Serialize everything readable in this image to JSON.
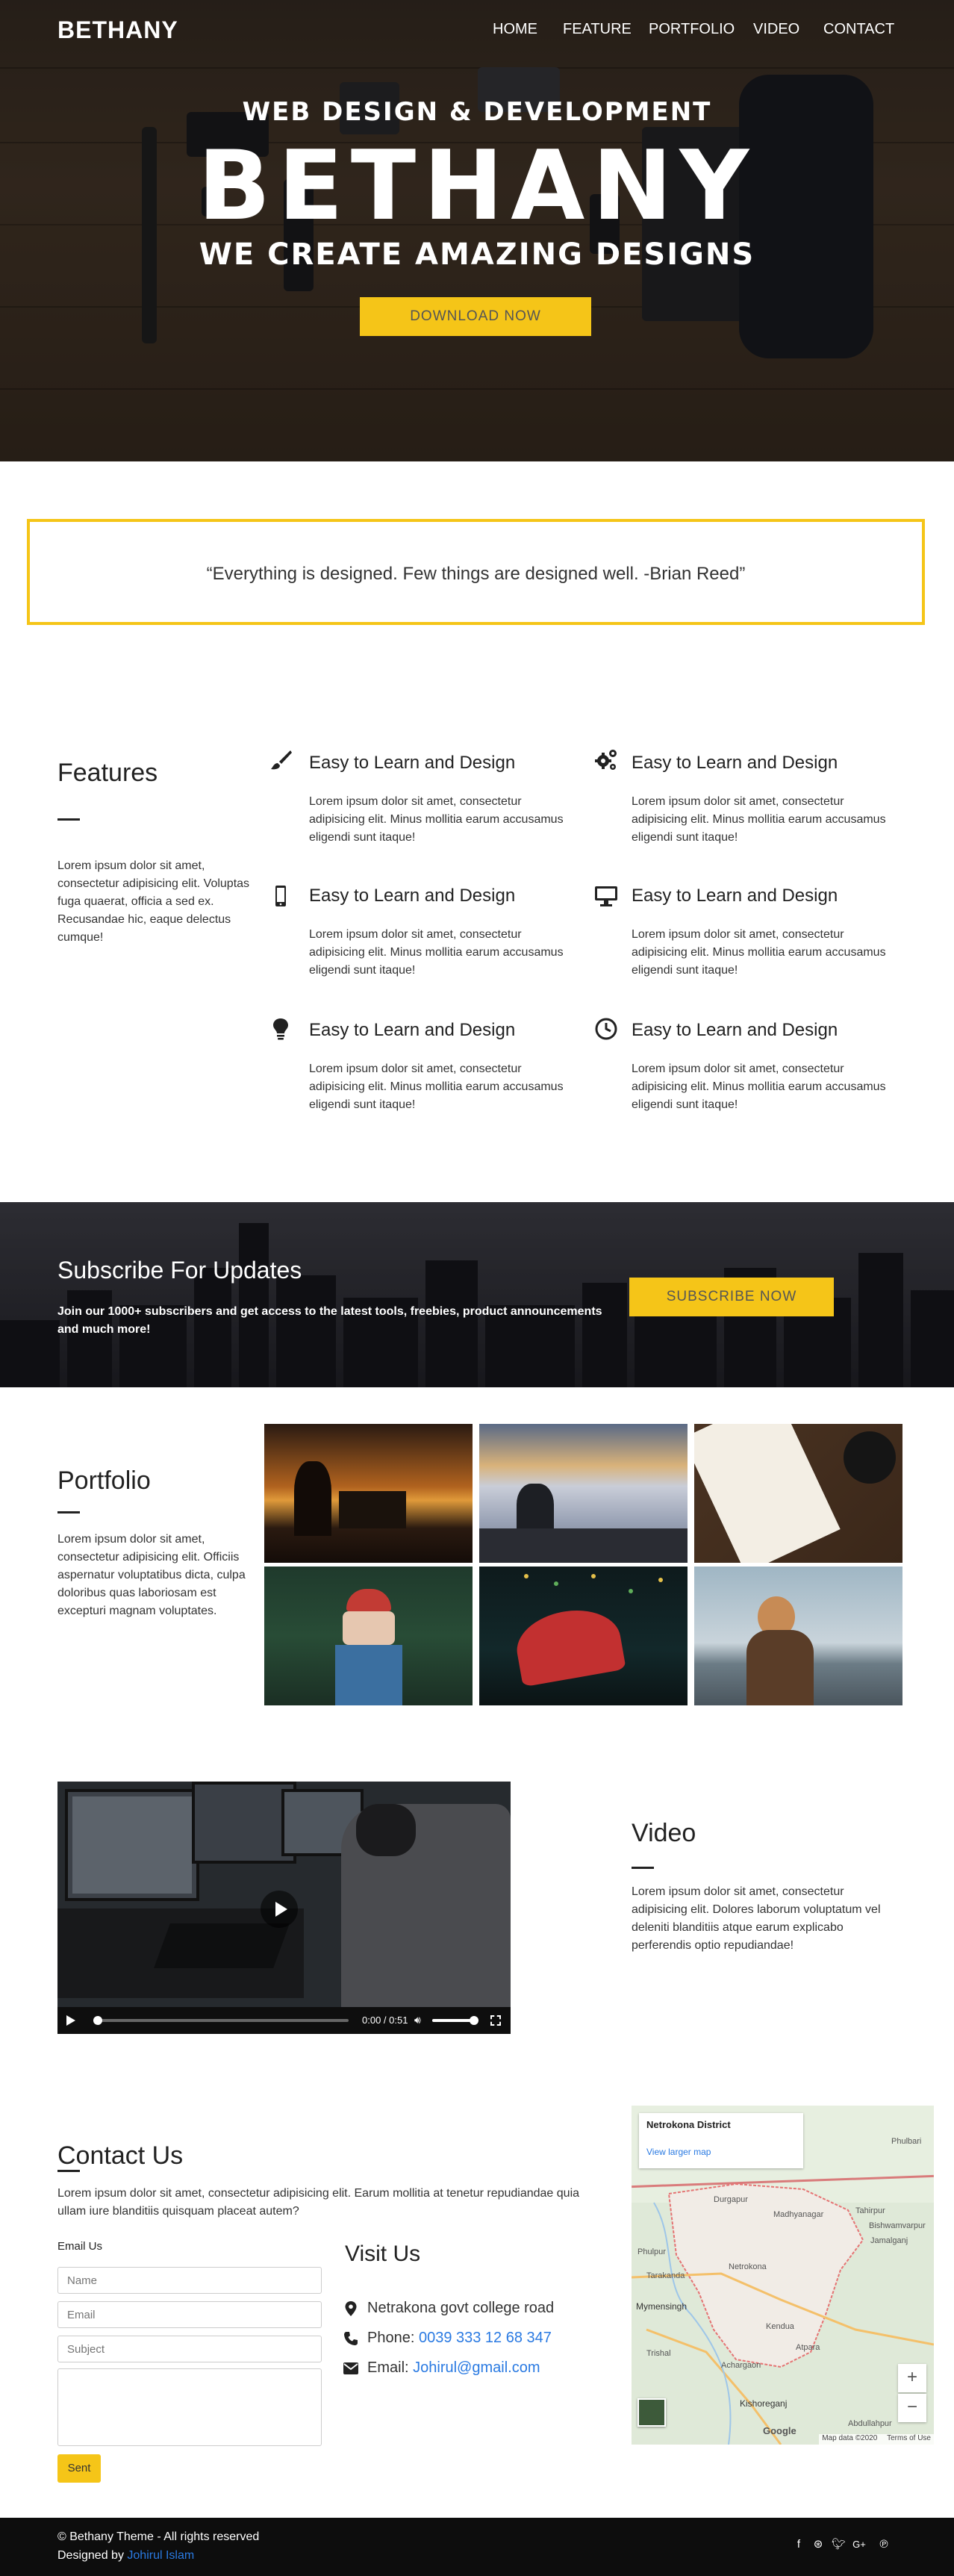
{
  "header": {
    "brand": "BETHANY",
    "nav": [
      "HOME",
      "FEATURE",
      "PORTFOLIO",
      "VIDEO",
      "CONTACT"
    ]
  },
  "hero": {
    "subtitle": "WEB DESIGN & DEVELOPMENT",
    "title": "BETHANY",
    "tagline": "WE CREATE AMAZING DESIGNS",
    "button": "DOWNLOAD NOW"
  },
  "quote": {
    "text": "“Everything is designed. Few things are designed well. -Brian Reed”"
  },
  "features": {
    "title": "Features",
    "description": "Lorem ipsum dolor sit amet, consectetur adipisicing elit. Voluptas fuga quaerat, officia a sed ex. Recusandae hic, eaque delectus cumque!",
    "items": [
      {
        "icon": "brush-icon",
        "title": "Easy to Learn and Design",
        "text": "Lorem ipsum dolor sit amet, consectetur adipisicing elit. Minus mollitia earum accusamus eligendi sunt itaque!"
      },
      {
        "icon": "gears-icon",
        "title": "Easy to Learn and Design",
        "text": "Lorem ipsum dolor sit amet, consectetur adipisicing elit. Minus mollitia earum accusamus eligendi sunt itaque!"
      },
      {
        "icon": "mobile-icon",
        "title": "Easy to Learn and Design",
        "text": "Lorem ipsum dolor sit amet, consectetur adipisicing elit. Minus mollitia earum accusamus eligendi sunt itaque!"
      },
      {
        "icon": "desktop-icon",
        "title": "Easy to Learn and Design",
        "text": "Lorem ipsum dolor sit amet, consectetur adipisicing elit. Minus mollitia earum accusamus eligendi sunt itaque!"
      },
      {
        "icon": "lightbulb-icon",
        "title": "Easy to Learn and Design",
        "text": "Lorem ipsum dolor sit amet, consectetur adipisicing elit. Minus mollitia earum accusamus eligendi sunt itaque!"
      },
      {
        "icon": "clock-icon",
        "title": "Easy to Learn and Design",
        "text": "Lorem ipsum dolor sit amet, consectetur adipisicing elit. Minus mollitia earum accusamus eligendi sunt itaque!"
      }
    ]
  },
  "subscribe": {
    "title": "Subscribe For Updates",
    "text": "Join our 1000+ subscribers and get access to the latest tools, freebies, product announcements and much more!",
    "button": "SUBSCRIBE NOW"
  },
  "portfolio": {
    "title": "Portfolio",
    "description": "Lorem ipsum dolor sit amet, consectetur adipisicing elit. Officiis aspernatur voluptatibus dicta, culpa doloribus quas laboriosam est excepturi magnam voluptates."
  },
  "video": {
    "title": "Video",
    "description": "Lorem ipsum dolor sit amet, consectetur adipisicing elit. Dolores laborum voluptatum vel deleniti blanditiis atque earum explicabo perferendis optio repudiandae!",
    "time": "0:00 / 0:51",
    "progress": 0.0,
    "volume": 0.9
  },
  "contact": {
    "title": "Contact Us",
    "description": "Lorem ipsum dolor sit amet, consectetur adipisicing elit. Earum mollitia at tenetur repudiandae quia ullam iure blanditiis quisquam placeat autem?",
    "email_label": "Email Us",
    "placeholders": {
      "name": "Name",
      "email": "Email",
      "subject": "Subject"
    },
    "send_button": "Sent"
  },
  "visit": {
    "title": "Visit Us",
    "address": "Netrakona govt college road",
    "phone_label": "Phone:",
    "phone": "0039 333 12 68 347",
    "email_label": "Email:",
    "email": "Johirul@gmail.com"
  },
  "map": {
    "place": "Netrokona District",
    "link": "View larger map",
    "labels": [
      "Phulbari",
      "Durgapur",
      "Madhyanagar",
      "Tahirpur",
      "Bishwamvarpur",
      "Jamalganj",
      "Phulpur",
      "Tarakanda",
      "Netrokona",
      "Mymensingh",
      "Kendua",
      "Trishal",
      "Atpara",
      "Achargaon",
      "Kishoreganj",
      "Abdullahpur"
    ],
    "zoom_in": "+",
    "zoom_out": "−",
    "attribution": "Map data ©2020",
    "terms": "Terms of Use",
    "logo": "Google"
  },
  "footer": {
    "copyright": "© Bethany Theme - All rights reserved",
    "designed_by": "Designed by",
    "author": "Johirul Islam",
    "social": [
      "facebook-icon",
      "dribbble-icon",
      "twitter-icon",
      "google-plus-icon",
      "pinterest-icon"
    ]
  },
  "colors": {
    "accent": "#f5c518",
    "link": "#2a7ae2",
    "footer": "#0d0d0d"
  }
}
